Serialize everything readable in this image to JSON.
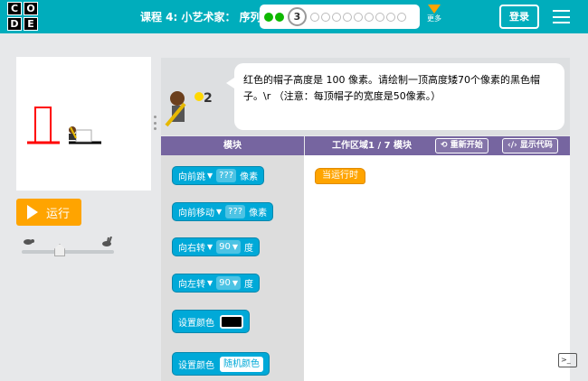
{
  "header": {
    "logo_letters": [
      "C",
      "O",
      "D",
      "E"
    ],
    "lesson_title": "课程 4: 小艺术家： 序列",
    "current_puzzle": "3",
    "more_label": "更多",
    "login_label": "登录"
  },
  "controls": {
    "run_label": "运行"
  },
  "instructions": {
    "badge": "2",
    "text": "红色的帽子高度是 100 像素。请绘制一顶高度矮70个像素的黑色帽子。\\r （注意：每顶帽子的宽度是50像素。）"
  },
  "toolbox": {
    "header": "模块",
    "blocks": [
      {
        "label": "向前跳",
        "value": "???",
        "unit": "像素"
      },
      {
        "label": "向前移动",
        "value": "???",
        "unit": "像素"
      },
      {
        "label": "向右转",
        "value": "90",
        "unit": "度"
      },
      {
        "label": "向左转",
        "value": "90",
        "unit": "度"
      },
      {
        "label": "设置颜色",
        "swatch": "#000000"
      },
      {
        "label": "设置颜色",
        "value": "随机颜色"
      }
    ]
  },
  "workspace": {
    "header": "工作区域1 / 7 模块",
    "restart_label": "重新开始",
    "show_code_label": "显示代码",
    "start_block": "当运行时"
  },
  "colors": {
    "header_bg": "#00adbc",
    "run_button": "#ffa400",
    "block_blue": "#00a9d8",
    "workspace_header": "#7665a0",
    "hat_red": "#ff0000"
  }
}
